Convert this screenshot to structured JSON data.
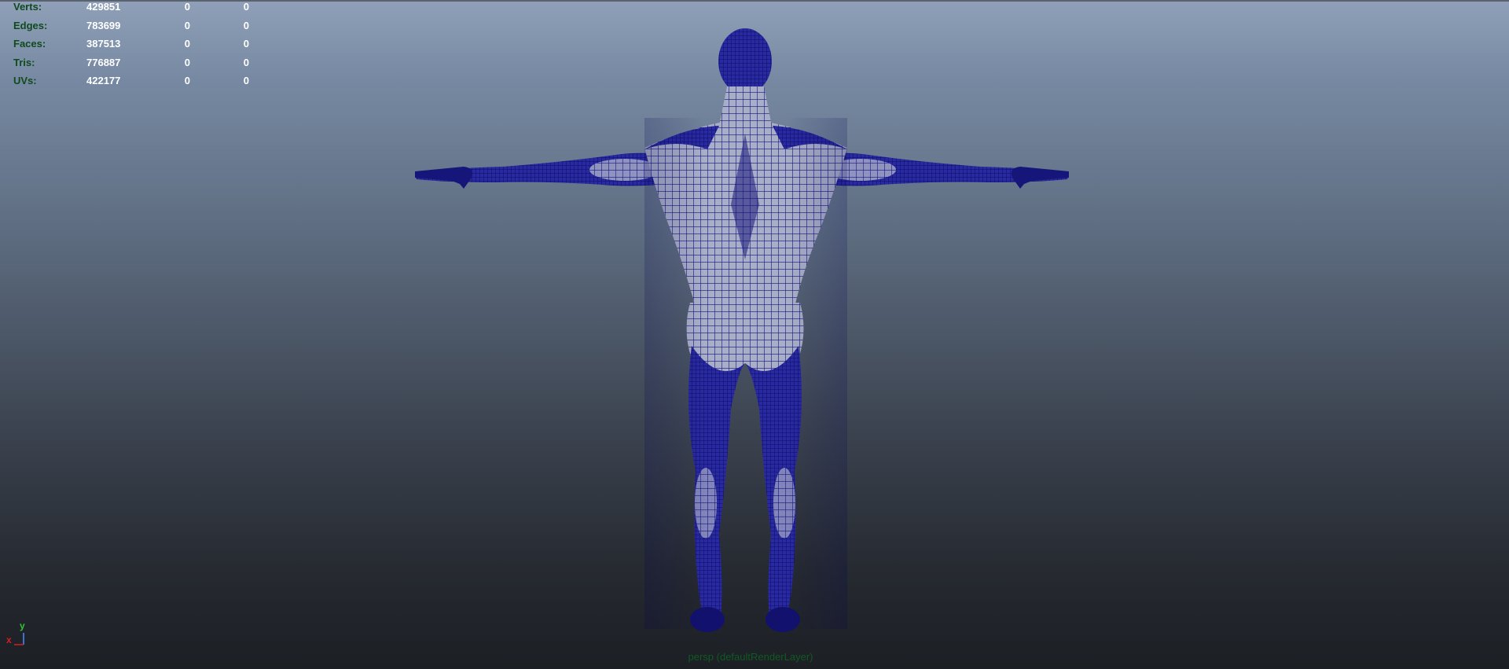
{
  "hud": {
    "rows": [
      {
        "label": "Verts:",
        "total": "429851",
        "selected": "0",
        "component": "0"
      },
      {
        "label": "Edges:",
        "total": "783699",
        "selected": "0",
        "component": "0"
      },
      {
        "label": "Faces:",
        "total": "387513",
        "selected": "0",
        "component": "0"
      },
      {
        "label": "Tris:",
        "total": "776887",
        "selected": "0",
        "component": "0"
      },
      {
        "label": "UVs:",
        "total": "422177",
        "selected": "0",
        "component": "0"
      }
    ]
  },
  "axis": {
    "x": "x",
    "y": "y"
  },
  "camera_label": "persp (defaultRenderLayer)",
  "colors": {
    "wire": "#1a1a8c",
    "hud_label": "#0f4a1e",
    "hud_value": "#ffffff",
    "axis_x": "#d42020",
    "axis_y": "#34c234"
  },
  "icons": {
    "axis": "axis-gizmo-icon",
    "model": "wireframe-human-mesh"
  }
}
